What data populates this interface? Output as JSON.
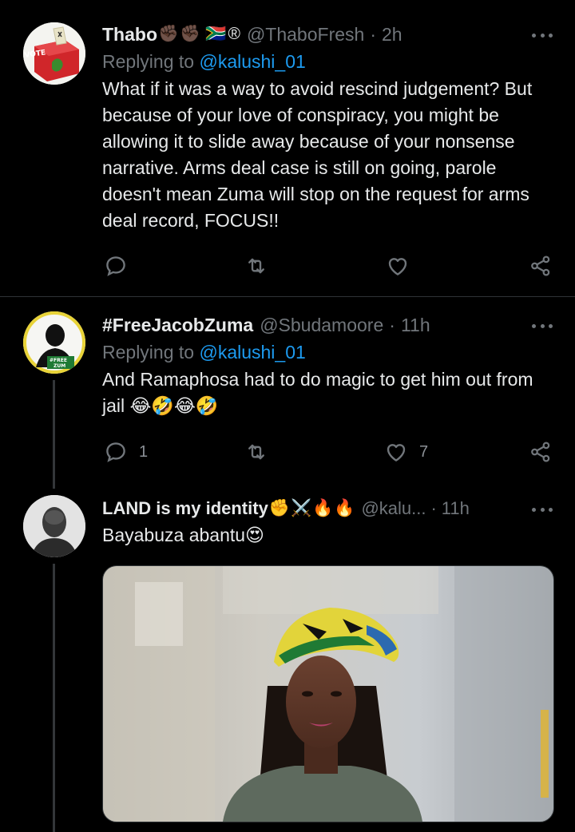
{
  "tweets": [
    {
      "display_name": "Thabo",
      "emojis": [
        "✊🏿",
        "✊🏿",
        "🇿🇦",
        "®"
      ],
      "handle": "@ThaboFresh",
      "time": "2h",
      "replying_label": "Replying to ",
      "replying_to": "@kalushi_01",
      "text": "What if it was a way to avoid rescind judgement? But because of your love of conspiracy, you might be allowing it to slide away because of your nonsense narrative. Arms deal case is still on going, parole doesn't mean Zuma will stop on the request for arms deal record, FOCUS!!",
      "avatar_text": "VOTE",
      "reply_count": "",
      "retweet_count": "",
      "like_count": ""
    },
    {
      "display_name": "#FreeJacobZuma",
      "emojis": [],
      "handle": "@Sbudamoore",
      "time": "11h",
      "replying_label": "Replying to ",
      "replying_to": "@kalushi_01",
      "text": "And Ramaphosa had to do magic to get him out from jail 😂🤣😂🤣",
      "avatar_text": "#FREE ZUM",
      "reply_count": "1",
      "retweet_count": "",
      "like_count": "7"
    },
    {
      "display_name": "LAND is my identity",
      "emojis": [
        "✊",
        "⚔️",
        "🔥",
        "🔥"
      ],
      "handle": "@kalu...",
      "time": "11h",
      "text": "Bayabuza abantu😍"
    }
  ],
  "separator": "·",
  "colors": {
    "background": "#000000",
    "text": "#e7e9ea",
    "muted": "#71767b",
    "link": "#1d9bf0",
    "divider": "#2f3336"
  },
  "icons": [
    "reply-icon",
    "retweet-icon",
    "like-icon",
    "share-icon",
    "more-icon"
  ]
}
